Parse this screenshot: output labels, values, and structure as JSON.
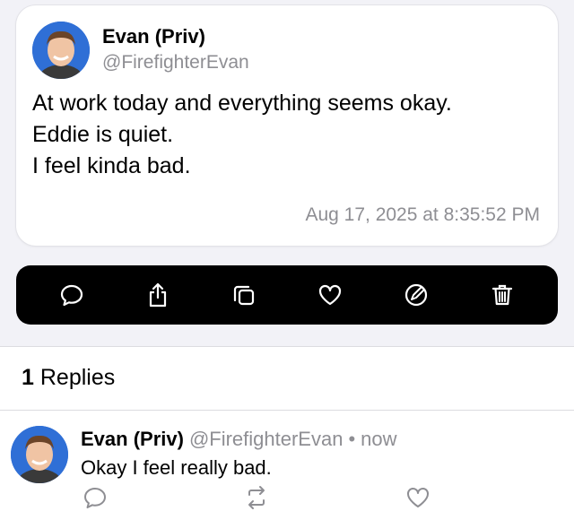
{
  "post": {
    "author_name": "Evan (Priv)",
    "handle": "@FirefighterEvan",
    "body_lines": [
      "At work today and everything seems okay.",
      "Eddie is quiet.",
      "I feel kinda bad."
    ],
    "timestamp": "Aug 17, 2025 at 8:35:52 PM"
  },
  "action_bar": {
    "icons": [
      "reply-icon",
      "share-icon",
      "copy-icon",
      "like-icon",
      "edit-icon",
      "delete-icon"
    ],
    "background": "#000000",
    "icon_color": "#ffffff"
  },
  "replies": {
    "count": "1",
    "label": "Replies",
    "items": [
      {
        "author_name": "Evan (Priv)",
        "handle": "@FirefighterEvan",
        "separator": "•",
        "time": "now",
        "text": "Okay I feel really bad.",
        "icons": [
          "reply-icon",
          "repost-icon",
          "like-icon"
        ]
      }
    ]
  },
  "colors": {
    "secondary_text": "#8e8e93",
    "page_background": "#f2f2f7",
    "avatar_background": "#2f6fd6"
  }
}
